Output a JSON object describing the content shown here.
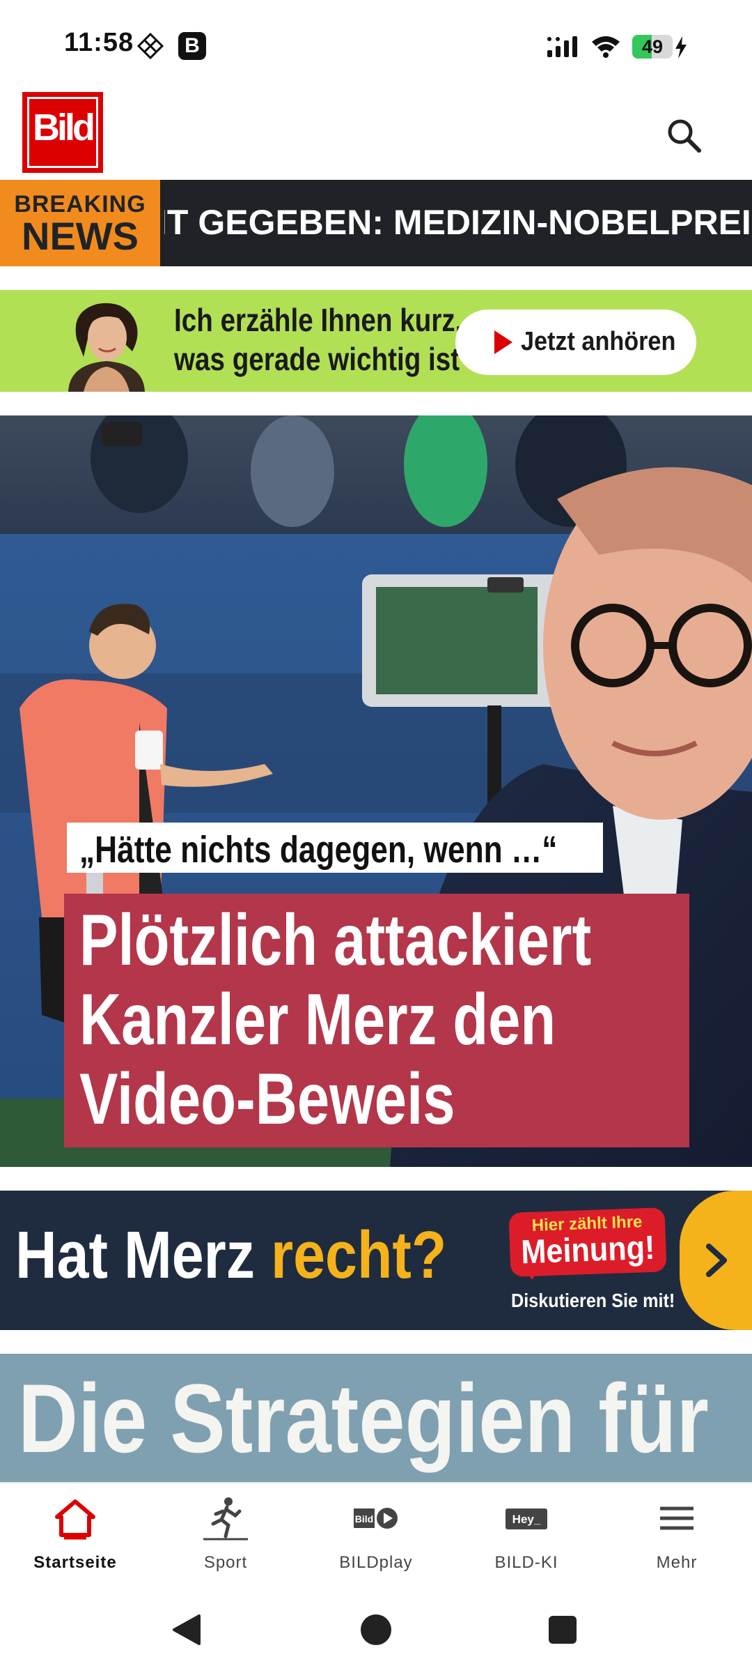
{
  "status_bar": {
    "time": "11:58",
    "b_badge": "B",
    "battery_level": "49",
    "battery_fraction": 0.49,
    "icons": [
      "diamond-grid-icon",
      "signal-icon",
      "wifi-icon",
      "battery-icon",
      "charging-bolt-icon"
    ]
  },
  "header": {
    "logo_text": "Bild",
    "search_icon": "search-icon"
  },
  "breaking": {
    "label_line1": "BREAKING",
    "label_line2": "NEWS",
    "ticker_text": "IT GEGEBEN: MEDIZIN-NOBELPREIS FÜR JA"
  },
  "audio_promo": {
    "line1": "Ich erzähle Ihnen kurz,",
    "line2": "was gerade wichtig ist",
    "button_label": "Jetzt anhören"
  },
  "hero": {
    "kicker": "„Hätte nichts dagegen, wenn …“",
    "headline_lines": [
      "Plötzlich attackiert",
      "Kanzler Merz den",
      "Video-Beweis"
    ]
  },
  "opinion_banner": {
    "question_part1": "Hat Merz ",
    "question_part2": "recht?",
    "bubble_line1": "Hier zählt Ihre",
    "bubble_line2": "Meinung!",
    "cta": "Diskutieren Sie mit!"
  },
  "next_article": {
    "title": "Die Strategien für"
  },
  "bottom_nav": {
    "items": [
      {
        "label": "Startseite",
        "icon": "home-icon",
        "active": true
      },
      {
        "label": "Sport",
        "icon": "runner-icon",
        "active": false
      },
      {
        "label": "BILDplay",
        "icon": "bildplay-icon",
        "active": false
      },
      {
        "label": "BILD-KI",
        "icon": "hey-icon",
        "active": false,
        "icon_text": "Hey_"
      },
      {
        "label": "Mehr",
        "icon": "menu-icon",
        "active": false
      }
    ]
  },
  "colors": {
    "bild_red": "#dd0000",
    "breaking_orange": "#f28b1d",
    "ticker_dark": "#1f2328",
    "promo_green": "#b2e055",
    "headline_red": "#b3364a",
    "opinion_navy": "#1f2c3f",
    "opinion_yellow": "#f5b21b"
  }
}
